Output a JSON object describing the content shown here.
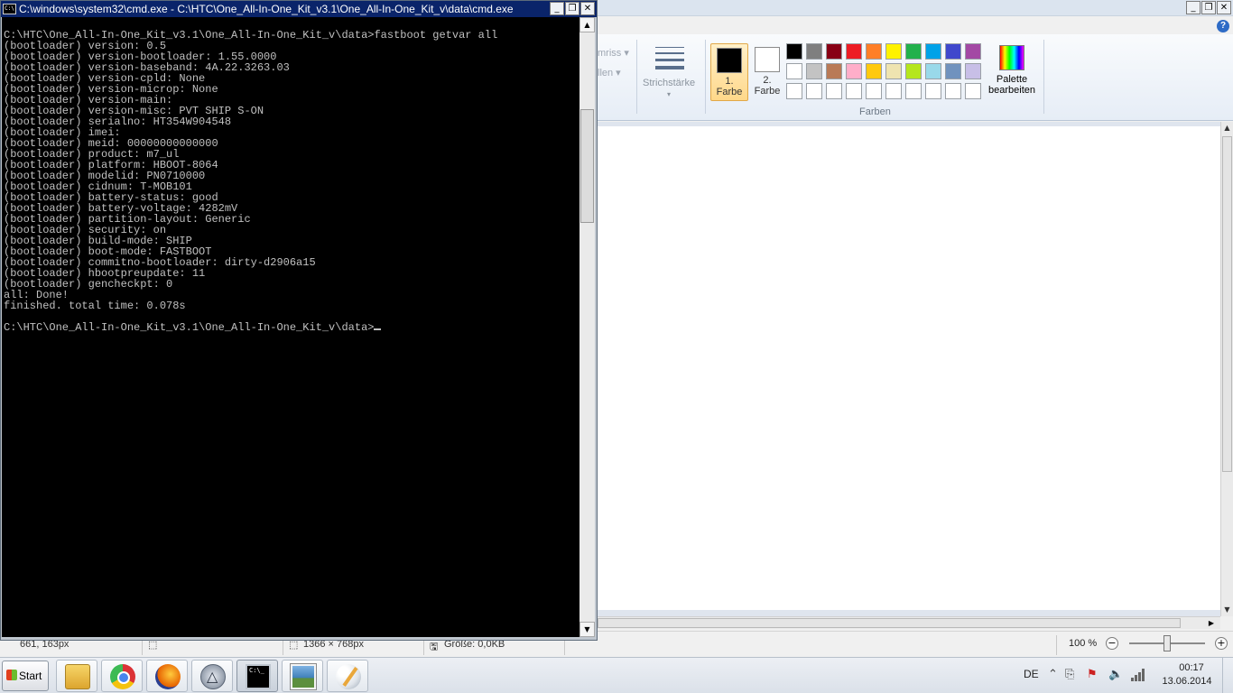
{
  "paint": {
    "title_buttons": {
      "minimize": "_",
      "maximize": "❐",
      "close": "✕"
    },
    "help_icon": "?",
    "ribbon": {
      "faded_outline": "mriss ▾",
      "faded_fill": "llen ▾",
      "stroke_label": "Strichstärke",
      "stroke_arrow": "▾",
      "color1_label_line1": "1.",
      "color1_label_line2": "Farbe",
      "color2_label_line1": "2.",
      "color2_label_line2": "Farbe",
      "group_label": "Farben",
      "edit_palette_line1": "Palette",
      "edit_palette_line2": "bearbeiten",
      "color1": "#000000",
      "color2": "#ffffff",
      "palette_colors": [
        "#000000",
        "#7f7f7f",
        "#880015",
        "#ed1c24",
        "#ff7f27",
        "#fff200",
        "#22b14c",
        "#00a2e8",
        "#3f48cc",
        "#a349a4",
        "#ffffff",
        "#c3c3c3",
        "#b97a57",
        "#ffaec9",
        "#ffc90e",
        "#efe4b0",
        "#b5e61d",
        "#99d9ea",
        "#7092be",
        "#c8bfe7",
        "#ffffff",
        "#ffffff",
        "#ffffff",
        "#ffffff",
        "#ffffff",
        "#ffffff",
        "#ffffff",
        "#ffffff",
        "#ffffff",
        "#ffffff"
      ]
    },
    "statusbar": {
      "cursor_pos": "661, 163px",
      "canvas_size": "1366 × 768px",
      "file_size": "Größe: 0,0KB",
      "zoom": "100 %",
      "zoom_minus": "−",
      "zoom_plus": "+"
    }
  },
  "cmd": {
    "title": "C:\\windows\\system32\\cmd.exe - C:\\HTC\\One_All-In-One_Kit_v3.1\\One_All-In-One_Kit_v\\data\\cmd.exe",
    "icon_text": "C:\\",
    "title_buttons": {
      "minimize": "_",
      "maximize": "❐",
      "close": "✕"
    },
    "scroll_up": "▲",
    "scroll_down": "▼",
    "lines": [
      "C:\\HTC\\One_All-In-One_Kit_v3.1\\One_All-In-One_Kit_v\\data>fastboot getvar all",
      "(bootloader) version: 0.5",
      "(bootloader) version-bootloader: 1.55.0000",
      "(bootloader) version-baseband: 4A.22.3263.03",
      "(bootloader) version-cpld: None",
      "(bootloader) version-microp: None",
      "(bootloader) version-main:",
      "(bootloader) version-misc: PVT SHIP S-ON",
      "(bootloader) serialno: HT354W904548",
      "(bootloader) imei:",
      "(bootloader) meid: 00000000000000",
      "(bootloader) product: m7_ul",
      "(bootloader) platform: HBOOT-8064",
      "(bootloader) modelid: PN0710000",
      "(bootloader) cidnum: T-MOB101",
      "(bootloader) battery-status: good",
      "(bootloader) battery-voltage: 4282mV",
      "(bootloader) partition-layout: Generic",
      "(bootloader) security: on",
      "(bootloader) build-mode: SHIP",
      "(bootloader) boot-mode: FASTBOOT",
      "(bootloader) commitno-bootloader: dirty-d2906a15",
      "(bootloader) hbootpreupdate: 11",
      "(bootloader) gencheckpt: 0",
      "all: Done!",
      "finished. total time: 0.078s",
      "",
      "C:\\HTC\\One_All-In-One_Kit_v3.1\\One_All-In-One_Kit_v\\data>"
    ]
  },
  "taskbar": {
    "start_label": "Start",
    "cmd_icon_text": "C:\\_",
    "language": "DE",
    "tray_arrow": "⌃",
    "tray_volume": "🔈",
    "clock_time": "00:17",
    "clock_date": "13.06.2014"
  }
}
